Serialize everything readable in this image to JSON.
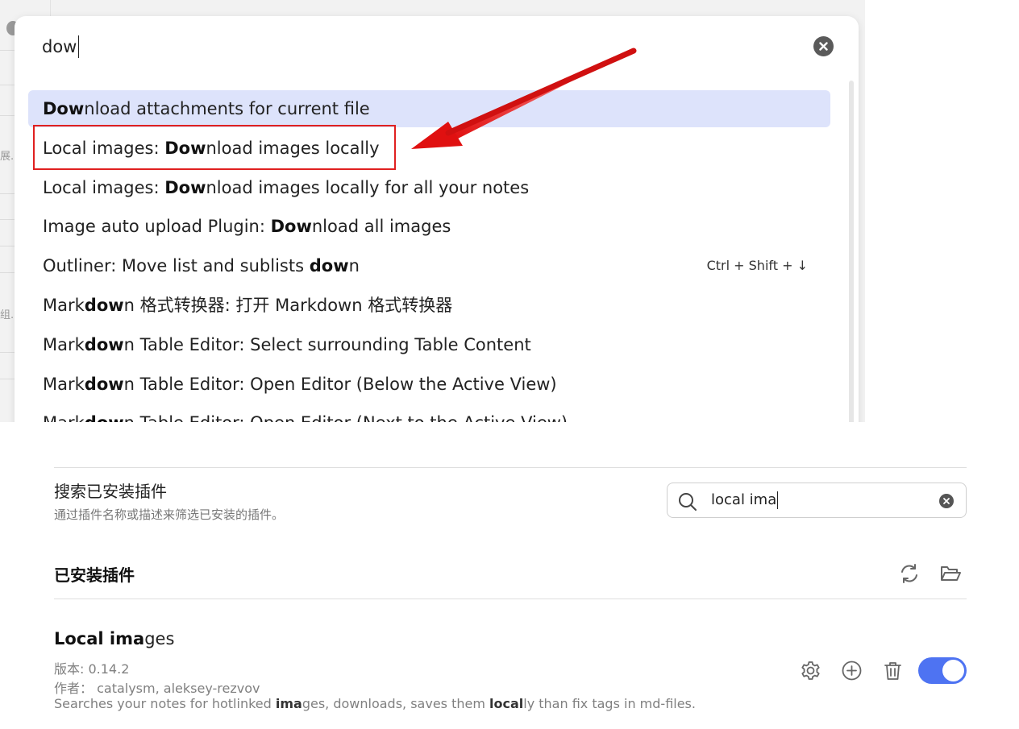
{
  "palette": {
    "query": "dow",
    "suggestions": [
      {
        "parts": [
          [
            "Dow",
            true
          ],
          [
            "nload attachments for current file",
            false
          ]
        ],
        "selected": true,
        "hotkey": ""
      },
      {
        "parts": [
          [
            "Local images: ",
            false
          ],
          [
            "Dow",
            true
          ],
          [
            "nload images locally",
            false
          ]
        ],
        "selected": false,
        "hotkey": ""
      },
      {
        "parts": [
          [
            "Local images: ",
            false
          ],
          [
            "Dow",
            true
          ],
          [
            "nload images locally for all your notes",
            false
          ]
        ],
        "selected": false,
        "hotkey": ""
      },
      {
        "parts": [
          [
            "Image auto upload Plugin: ",
            false
          ],
          [
            "Dow",
            true
          ],
          [
            "nload all images",
            false
          ]
        ],
        "selected": false,
        "hotkey": ""
      },
      {
        "parts": [
          [
            "Outliner: Move list and sublists ",
            false
          ],
          [
            "dow",
            true
          ],
          [
            "n",
            false
          ]
        ],
        "selected": false,
        "hotkey": "Ctrl + Shift + ↓"
      },
      {
        "parts": [
          [
            "Mark",
            false
          ],
          [
            "dow",
            true
          ],
          [
            "n 格式转换器: 打开 Markdown 格式转换器",
            false
          ]
        ],
        "selected": false,
        "hotkey": ""
      },
      {
        "parts": [
          [
            "Mark",
            false
          ],
          [
            "dow",
            true
          ],
          [
            "n Table Editor: Select surrounding Table Content",
            false
          ]
        ],
        "selected": false,
        "hotkey": ""
      },
      {
        "parts": [
          [
            "Mark",
            false
          ],
          [
            "dow",
            true
          ],
          [
            "n Table Editor: Open Editor (Below the Active View)",
            false
          ]
        ],
        "selected": false,
        "hotkey": ""
      },
      {
        "parts": [
          [
            "Mark",
            false
          ],
          [
            "dow",
            true
          ],
          [
            "n Table Editor: Open Editor (Next to the Active View)",
            false
          ]
        ],
        "selected": false,
        "hotkey": ""
      }
    ]
  },
  "background_fragments": [
    "展.",
    "组."
  ],
  "settings": {
    "search_title": "搜索已安装插件",
    "search_desc": "通过插件名称或描述来筛选已安装的插件。",
    "search_value": "local ima",
    "installed_heading": "已安装插件",
    "plugin": {
      "name_bold": "Local ima",
      "name_rest": "ges",
      "version": "版本: 0.14.2",
      "author": "作者： catalysm, aleksey-rezvov",
      "desc_parts": [
        [
          "Searches your notes for hotlinked ",
          false
        ],
        [
          "ima",
          true
        ],
        [
          "ges, downloads, saves them ",
          false
        ],
        [
          "local",
          true
        ],
        [
          "ly than fix tags in md-files.",
          false
        ]
      ],
      "enabled": true
    }
  },
  "colors": {
    "accent": "#4e73f2",
    "selected_row": "#dde3fb",
    "annotation": "#e02020"
  }
}
